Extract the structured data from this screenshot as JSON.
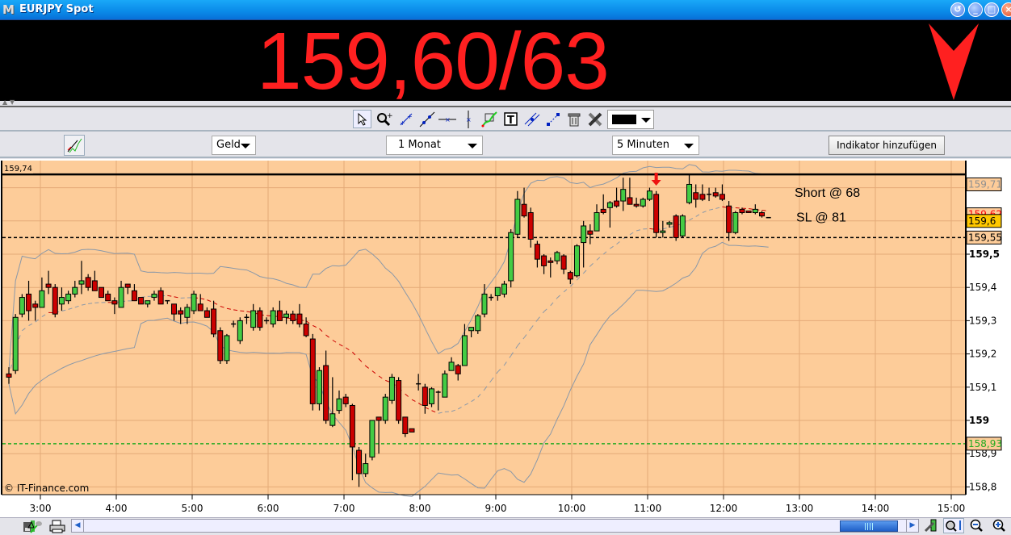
{
  "window": {
    "title": "EURJPY Spot",
    "logo": "M",
    "buttons": [
      "restore-icon",
      "minimize-icon",
      "maximize-icon",
      "close-icon"
    ]
  },
  "quote": {
    "price": "159,60/63",
    "direction": "down",
    "color": "#ff2020"
  },
  "toolbar": {
    "tools": [
      "pointer-icon",
      "zoom-icon",
      "line-icon",
      "trendline-icon",
      "horizontal-line-icon",
      "vertical-line-icon",
      "fibonacci-icon",
      "text-icon",
      "channel-icon",
      "extend-line-icon",
      "trash-icon",
      "tools-icon"
    ],
    "color_value": "#000000"
  },
  "controls": {
    "price_type": "Geld",
    "period": "1 Monat",
    "interval": "5 Minuten",
    "add_indicator": "Indikator hinzufügen"
  },
  "chart_data": {
    "type": "candlestick",
    "title": "EURJPY Spot",
    "watermark": "© IT-Finance.com",
    "ylim": [
      158.76,
      159.77
    ],
    "yticks": [
      "158,8",
      "158,9",
      "159",
      "159,1",
      "159,2",
      "159,3",
      "159,4",
      "159,5"
    ],
    "yticks_values": [
      158.8,
      158.9,
      159.0,
      159.1,
      159.2,
      159.3,
      159.4,
      159.5
    ],
    "xticks": [
      "3:00",
      "4:00",
      "5:00",
      "6:00",
      "7:00",
      "8:00",
      "9:00",
      "10:00",
      "11:00",
      "12:00",
      "13:00",
      "14:00",
      "15:00"
    ],
    "x_start": "2:35",
    "interval_minutes": 5,
    "top_left_label": "159,74",
    "hlines": [
      {
        "value": 159.74,
        "style": "solid",
        "color": "#000000"
      },
      {
        "value": 159.55,
        "style": "dashed",
        "color": "#000000"
      },
      {
        "value": 158.93,
        "style": "dashed",
        "color": "#22aa22"
      }
    ],
    "price_labels": [
      {
        "text": "159,71",
        "value": 159.71,
        "color": "#909090",
        "bg": "#fdcc99"
      },
      {
        "text": "159,62",
        "value": 159.62,
        "color": "#ff0000",
        "bg": "#fdcc99"
      },
      {
        "text": "159,6",
        "value": 159.6,
        "color": "#000000",
        "bg": "#ffc800"
      },
      {
        "text": "159,55",
        "value": 159.55,
        "color": "#000000",
        "bg": "#fdcc99"
      },
      {
        "text": "158,93",
        "value": 158.93,
        "color": "#22aa22",
        "bg": "#fdcc99"
      }
    ],
    "annotations": [
      {
        "text": "Short @ 68",
        "value": 159.685
      },
      {
        "text": "SL @ 81",
        "value": 159.61
      }
    ],
    "signal_candle": 98,
    "bollinger_period": 20,
    "candles": [
      [
        159.14,
        159.16,
        159.11,
        159.13
      ],
      [
        159.15,
        159.32,
        159.14,
        159.31
      ],
      [
        159.32,
        159.38,
        159.31,
        159.37
      ],
      [
        159.38,
        159.42,
        159.3,
        159.33
      ],
      [
        159.35,
        159.36,
        159.3,
        159.34
      ],
      [
        159.34,
        159.43,
        159.34,
        159.39
      ],
      [
        159.41,
        159.45,
        159.38,
        159.4
      ],
      [
        159.4,
        159.41,
        159.31,
        159.32
      ],
      [
        159.35,
        159.4,
        159.33,
        159.37
      ],
      [
        159.36,
        159.39,
        159.35,
        159.38
      ],
      [
        159.38,
        159.42,
        159.37,
        159.4
      ],
      [
        159.41,
        159.48,
        159.38,
        159.42
      ],
      [
        159.43,
        159.44,
        159.39,
        159.4
      ],
      [
        159.42,
        159.45,
        159.39,
        159.39
      ],
      [
        159.4,
        159.4,
        159.37,
        159.37
      ],
      [
        159.38,
        159.39,
        159.36,
        159.36
      ],
      [
        159.36,
        159.37,
        159.32,
        159.35
      ],
      [
        159.34,
        159.42,
        159.34,
        159.4
      ],
      [
        159.41,
        159.41,
        159.38,
        159.4
      ],
      [
        159.39,
        159.41,
        159.36,
        159.36
      ],
      [
        159.37,
        159.37,
        159.35,
        159.35
      ],
      [
        159.35,
        159.36,
        159.34,
        159.36
      ],
      [
        159.37,
        159.39,
        159.36,
        159.38
      ],
      [
        159.39,
        159.4,
        159.35,
        159.35
      ],
      [
        159.36,
        159.36,
        159.35,
        159.36
      ],
      [
        159.35,
        159.35,
        159.3,
        159.32
      ],
      [
        159.33,
        159.34,
        159.29,
        159.32
      ],
      [
        159.31,
        159.35,
        159.29,
        159.34
      ],
      [
        159.33,
        159.39,
        159.32,
        159.38
      ],
      [
        159.35,
        159.38,
        159.33,
        159.33
      ],
      [
        159.33,
        159.34,
        159.31,
        159.31
      ],
      [
        159.335,
        159.36,
        159.25,
        159.26
      ],
      [
        159.27,
        159.28,
        159.17,
        159.18
      ],
      [
        159.18,
        159.26,
        159.17,
        159.255
      ],
      [
        159.29,
        159.3,
        159.28,
        159.29
      ],
      [
        159.24,
        159.31,
        159.23,
        159.3
      ],
      [
        159.31,
        159.32,
        159.29,
        159.31
      ],
      [
        159.28,
        159.35,
        159.27,
        159.33
      ],
      [
        159.33,
        159.34,
        159.27,
        159.28
      ],
      [
        159.3,
        159.31,
        159.29,
        159.3
      ],
      [
        159.29,
        159.34,
        159.28,
        159.33
      ],
      [
        159.33,
        159.36,
        159.3,
        159.3
      ],
      [
        159.31,
        159.33,
        159.29,
        159.32
      ],
      [
        159.32,
        159.33,
        159.29,
        159.3
      ],
      [
        159.32,
        159.35,
        159.28,
        159.29
      ],
      [
        159.29,
        159.31,
        159.25,
        159.255
      ],
      [
        159.245,
        159.26,
        159.03,
        159.05
      ],
      [
        159.05,
        159.16,
        159.03,
        159.15
      ],
      [
        159.165,
        159.21,
        158.99,
        159.0
      ],
      [
        158.985,
        159.13,
        158.98,
        159.02
      ],
      [
        159.03,
        159.09,
        159.02,
        159.065
      ],
      [
        159.07,
        159.08,
        159.04,
        159.05
      ],
      [
        159.045,
        159.05,
        158.82,
        158.92
      ],
      [
        158.91,
        158.92,
        158.8,
        158.84
      ],
      [
        158.84,
        158.9,
        158.83,
        158.87
      ],
      [
        158.89,
        159.0,
        158.88,
        159.0
      ],
      [
        159.01,
        159.01,
        158.9,
        159.0
      ],
      [
        159.0,
        159.08,
        158.99,
        159.07
      ],
      [
        159.06,
        159.14,
        159.05,
        159.13
      ],
      [
        159.12,
        159.13,
        158.99,
        159.0
      ],
      [
        159.01,
        159.01,
        158.95,
        158.96
      ],
      [
        158.975,
        158.975,
        158.965,
        158.965
      ],
      [
        159.11,
        159.14,
        159.09,
        159.11
      ],
      [
        159.1,
        159.11,
        159.02,
        159.045
      ],
      [
        159.05,
        159.1,
        159.04,
        159.095
      ],
      [
        159.085,
        159.09,
        159.03,
        159.085
      ],
      [
        159.07,
        159.15,
        159.07,
        159.14
      ],
      [
        159.15,
        159.19,
        159.15,
        159.175
      ],
      [
        159.165,
        159.17,
        159.12,
        159.14
      ],
      [
        159.165,
        159.29,
        159.165,
        159.255
      ],
      [
        159.27,
        159.28,
        159.25,
        159.28
      ],
      [
        159.27,
        159.32,
        159.26,
        159.315
      ],
      [
        159.32,
        159.41,
        159.31,
        159.38
      ],
      [
        159.37,
        159.38,
        159.36,
        159.37
      ],
      [
        159.375,
        159.39,
        159.36,
        159.4
      ],
      [
        159.38,
        159.42,
        159.37,
        159.41
      ],
      [
        159.42,
        159.575,
        159.4,
        159.565
      ],
      [
        159.56,
        159.69,
        159.55,
        159.665
      ],
      [
        159.65,
        159.7,
        159.61,
        159.615
      ],
      [
        159.625,
        159.64,
        159.52,
        159.545
      ],
      [
        159.53,
        159.54,
        159.46,
        159.485
      ],
      [
        159.495,
        159.5,
        159.44,
        159.465
      ],
      [
        159.48,
        159.49,
        159.43,
        159.475
      ],
      [
        159.48,
        159.51,
        159.47,
        159.505
      ],
      [
        159.495,
        159.5,
        159.44,
        159.455
      ],
      [
        159.445,
        159.45,
        159.41,
        159.425
      ],
      [
        159.435,
        159.53,
        159.43,
        159.525
      ],
      [
        159.535,
        159.6,
        159.46,
        159.585
      ],
      [
        159.57,
        159.59,
        159.53,
        159.56
      ],
      [
        159.57,
        159.65,
        159.57,
        159.625
      ],
      [
        159.635,
        159.68,
        159.62,
        159.625
      ],
      [
        159.64,
        159.66,
        159.58,
        159.655
      ],
      [
        159.66,
        159.7,
        159.64,
        159.645
      ],
      [
        159.66,
        159.73,
        159.63,
        159.695
      ],
      [
        159.67,
        159.73,
        159.66,
        159.65
      ],
      [
        159.65,
        159.67,
        159.64,
        159.645
      ],
      [
        159.645,
        159.67,
        159.64,
        159.665
      ],
      [
        159.665,
        159.7,
        159.66,
        159.69
      ],
      [
        159.68,
        159.69,
        159.55,
        159.565
      ],
      [
        159.565,
        159.6,
        159.55,
        159.57
      ],
      [
        159.59,
        159.6,
        159.58,
        159.595
      ],
      [
        159.615,
        159.62,
        159.54,
        159.55
      ],
      [
        159.555,
        159.62,
        159.55,
        159.615
      ],
      [
        159.655,
        159.74,
        159.65,
        159.71
      ],
      [
        159.685,
        159.71,
        159.64,
        159.665
      ],
      [
        159.68,
        159.71,
        159.66,
        159.665
      ],
      [
        159.68,
        159.7,
        159.66,
        159.68
      ],
      [
        159.685,
        159.7,
        159.67,
        159.675
      ],
      [
        159.68,
        159.71,
        159.66,
        159.665
      ],
      [
        159.645,
        159.66,
        159.54,
        159.565
      ],
      [
        159.565,
        159.63,
        159.56,
        159.625
      ],
      [
        159.635,
        159.64,
        159.62,
        159.625
      ],
      [
        159.63,
        159.63,
        159.625,
        159.625
      ],
      [
        159.625,
        159.65,
        159.62,
        159.635
      ],
      [
        159.625,
        159.63,
        159.61,
        159.615
      ],
      [
        159.61,
        159.61,
        159.61,
        159.61
      ]
    ]
  },
  "bottom": {
    "tools": [
      "save-icon",
      "chart-type-icon",
      "print-icon",
      "chart-settings-icon",
      "autoscale-icon",
      "zoom-out-icon",
      "zoom-in-icon"
    ]
  }
}
